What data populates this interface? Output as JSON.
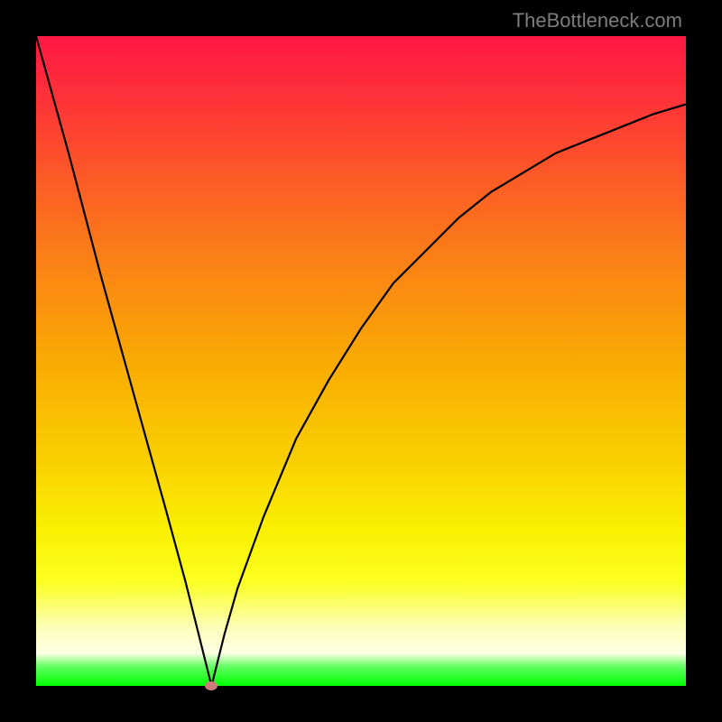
{
  "watermark": "TheBottleneck.com",
  "colors": {
    "frame": "#000000",
    "curve_stroke": "#000000",
    "marker": "#d07b7b"
  },
  "chart_data": {
    "type": "line",
    "title": "",
    "xlabel": "",
    "ylabel": "",
    "xlim": [
      0,
      100
    ],
    "ylim": [
      0,
      100
    ],
    "grid": false,
    "legend": false,
    "curve": {
      "description": "V-shaped bottleneck curve: starts at top-left, falls steeply to a minimum near x≈27, then rises with diminishing slope toward the top-right.",
      "x": [
        0,
        5,
        10,
        15,
        20,
        23,
        25,
        27,
        29,
        31,
        35,
        40,
        45,
        50,
        55,
        60,
        65,
        70,
        75,
        80,
        85,
        90,
        95,
        100
      ],
      "y": [
        100,
        82,
        63,
        45,
        27,
        16,
        8,
        0,
        8,
        15,
        26,
        38,
        47,
        55,
        62,
        67,
        72,
        76,
        79,
        82,
        84,
        86,
        88,
        89.5
      ]
    },
    "marker": {
      "x": 27,
      "y": 0,
      "label": ""
    }
  }
}
